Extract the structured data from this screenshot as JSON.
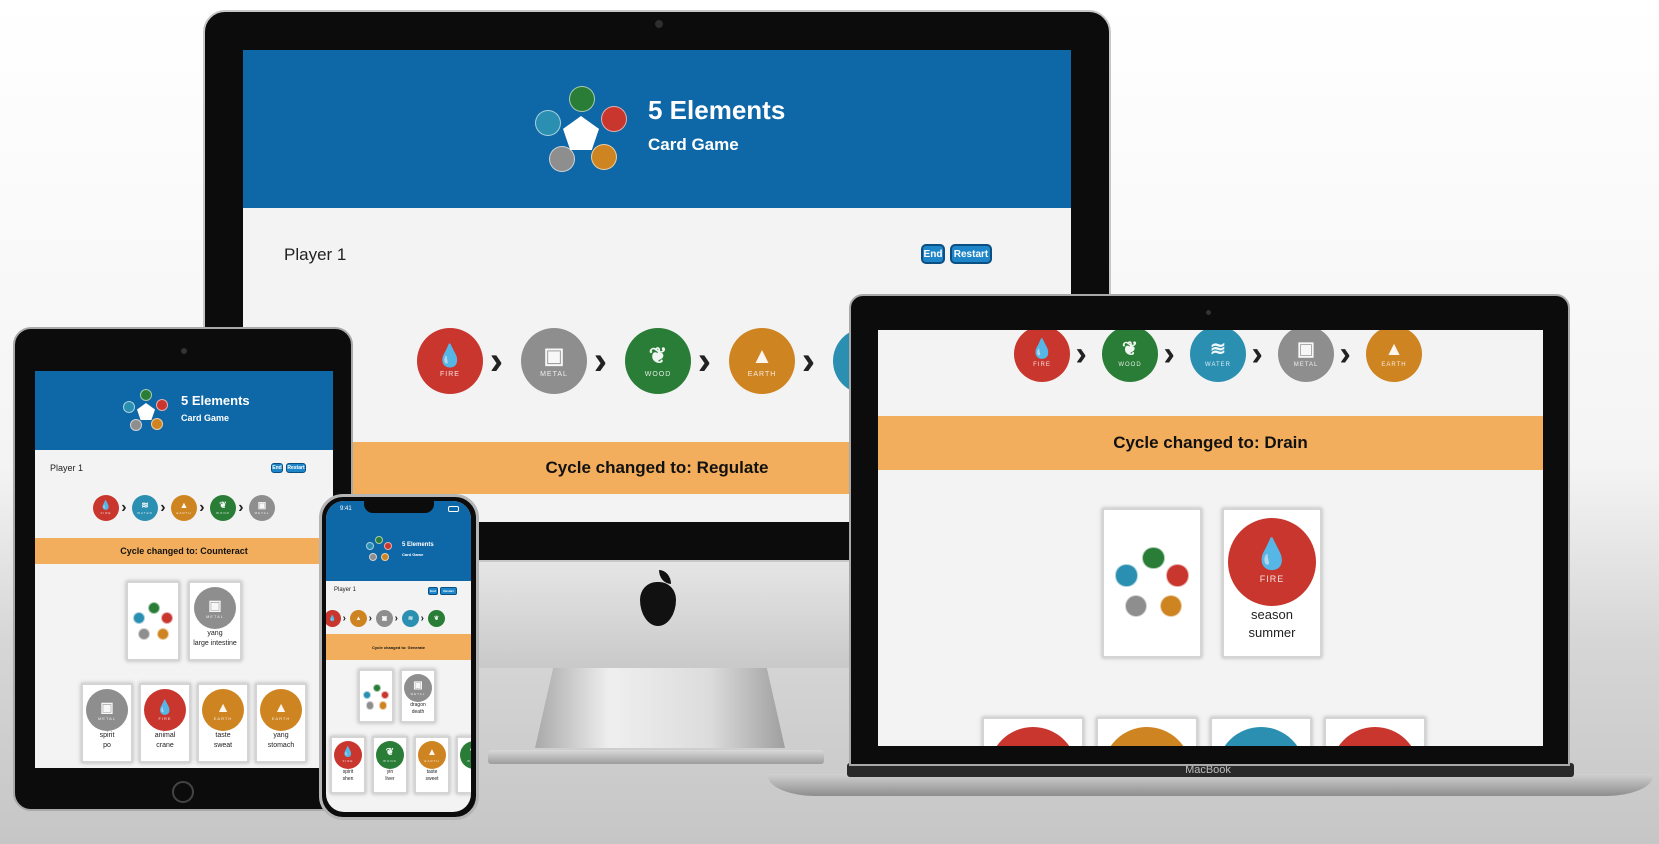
{
  "app": {
    "title": "5 Elements",
    "subtitle": "Card Game"
  },
  "colors": {
    "header": "#0e67a6",
    "banner": "#f2ae5c",
    "button": "#1e86c8",
    "fire": "#c8362e",
    "metal": "#8e8e8e",
    "wood": "#2a7d36",
    "earth": "#cf8422",
    "water": "#2a8fb1"
  },
  "elements": {
    "fire": {
      "label": "FIRE",
      "icon": "fire-icon",
      "glyph": "💧"
    },
    "metal": {
      "label": "METAL",
      "icon": "metal-icon",
      "glyph": "▣"
    },
    "wood": {
      "label": "WOOD",
      "icon": "wood-icon",
      "glyph": "❦"
    },
    "earth": {
      "label": "EARTH",
      "icon": "earth-icon",
      "glyph": "▲"
    },
    "water": {
      "label": "WATER",
      "icon": "water-icon",
      "glyph": "≋"
    }
  },
  "devices": {
    "imac": {
      "player": "Player 1",
      "end_label": "End",
      "restart_label": "Restart",
      "cycle": [
        "fire",
        "metal",
        "wood",
        "earth",
        "water"
      ],
      "banner": "Cycle changed to: Regulate"
    },
    "laptop": {
      "brand": "MacBook",
      "cycle": [
        "fire",
        "wood",
        "water",
        "metal",
        "earth"
      ],
      "banner": "Cycle changed to: Drain",
      "cards": [
        {
          "type": "logo"
        },
        {
          "type": "element",
          "element": "fire",
          "lines": [
            "season",
            "summer"
          ]
        }
      ],
      "hand": [
        "fire",
        "earth",
        "water",
        "fire"
      ]
    },
    "tablet": {
      "player": "Player 1",
      "end_label": "End",
      "restart_label": "Restart",
      "cycle": [
        "fire",
        "water",
        "earth",
        "wood",
        "metal"
      ],
      "banner": "Cycle changed to: Counteract",
      "cards": [
        {
          "type": "logo"
        },
        {
          "type": "element",
          "element": "metal",
          "lines": [
            "yang",
            "large intestine"
          ]
        }
      ],
      "hand": [
        {
          "element": "metal",
          "lines": [
            "spirit",
            "po"
          ]
        },
        {
          "element": "fire",
          "lines": [
            "animal",
            "crane"
          ]
        },
        {
          "element": "earth",
          "lines": [
            "taste",
            "sweat"
          ]
        },
        {
          "element": "earth",
          "lines": [
            "yang",
            "stomach"
          ]
        }
      ]
    },
    "phone": {
      "time": "9:41",
      "player": "Player 1",
      "end_label": "End",
      "restart_label": "Restart",
      "cycle": [
        "fire",
        "earth",
        "metal",
        "water",
        "wood"
      ],
      "banner": "Cycle changed to: Generate",
      "cards": [
        {
          "type": "logo"
        },
        {
          "type": "element",
          "element": "metal",
          "lines": [
            "dragon",
            "death"
          ]
        }
      ],
      "hand": [
        {
          "element": "fire",
          "lines": [
            "spirit",
            "shen"
          ]
        },
        {
          "element": "wood",
          "lines": [
            "yin",
            "liver"
          ]
        },
        {
          "element": "earth",
          "lines": [
            "taste",
            "sweet"
          ]
        },
        {
          "element": "wood",
          "lines": [
            "",
            ""
          ]
        }
      ]
    }
  }
}
